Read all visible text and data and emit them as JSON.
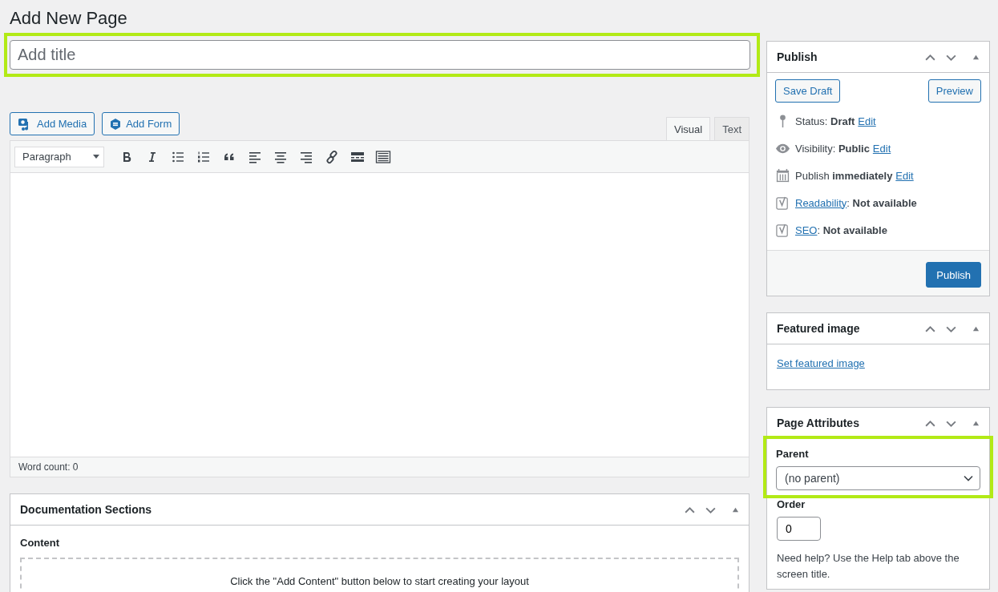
{
  "page_title": "Add New Page",
  "title_field": {
    "placeholder": "Add title",
    "highlighted": true
  },
  "media_buttons": [
    {
      "kind": "media",
      "label": "Add Media"
    },
    {
      "kind": "form",
      "label": "Add Form"
    }
  ],
  "editor_tabs": [
    {
      "label": "Visual",
      "selected": true
    },
    {
      "label": "Text",
      "selected": false
    }
  ],
  "format_select": {
    "value": "Paragraph"
  },
  "word_count": "Word count: 0",
  "documentation": {
    "title": "Documentation Sections",
    "content_label": "Content",
    "hint": "Click the \"Add Content\" button below to start creating your layout"
  },
  "publish": {
    "title": "Publish",
    "save_draft": "Save Draft",
    "preview": "Preview",
    "rows": [
      {
        "kind": "pin",
        "pre": "Status: **Draft**",
        "link": "Edit",
        "post": ""
      },
      {
        "kind": "eye",
        "pre": "Visibility: **Public**",
        "link": "Edit",
        "post": ""
      },
      {
        "kind": "calendar",
        "pre": "Publish **immediately**",
        "link": "Edit",
        "post": ""
      },
      {
        "kind": "yoast",
        "pre": "",
        "link": "Readability",
        "post": ": **Not available**"
      },
      {
        "kind": "yoast",
        "pre": "",
        "link": "SEO",
        "post": ": **Not available**"
      }
    ],
    "button": "Publish"
  },
  "featured_image": {
    "title": "Featured image",
    "link": "Set featured image"
  },
  "page_attributes": {
    "title": "Page Attributes",
    "parent_label": "Parent",
    "parent_value": "(no parent)",
    "highlighted": true,
    "order_label": "Order",
    "order_value": "0",
    "help": "Need help? Use the Help tab above the screen title."
  }
}
